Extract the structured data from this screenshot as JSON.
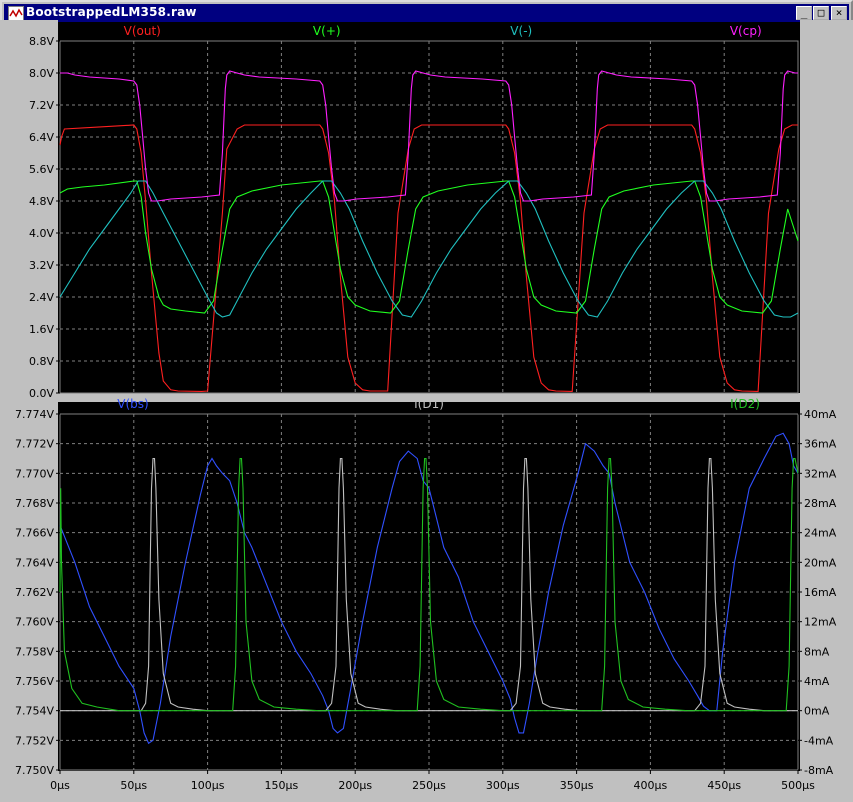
{
  "window": {
    "title": "BootstrappedLM358.raw",
    "controls": [
      "_",
      "□",
      "×"
    ]
  },
  "chart_data": [
    {
      "type": "line",
      "pane": "top",
      "y_ticks": [
        "0.0V",
        "0.8V",
        "1.6V",
        "2.4V",
        "3.2V",
        "4.0V",
        "4.8V",
        "5.6V",
        "6.4V",
        "7.2V",
        "8.0V",
        "8.8V"
      ],
      "ylim": [
        0,
        8.8
      ],
      "xlim": [
        0,
        500
      ],
      "grid": true,
      "series": [
        {
          "name": "V(out)",
          "color": "#ff2020",
          "x": [
            0,
            1,
            3,
            50,
            52,
            55,
            58,
            62,
            67,
            70,
            75,
            80,
            96,
            100,
            110,
            113,
            120,
            125,
            176,
            178,
            182,
            186,
            190,
            195,
            200,
            205,
            210,
            222,
            229,
            236,
            240,
            245,
            250,
            302,
            304,
            308,
            312,
            316,
            321,
            326,
            331,
            336,
            347,
            355,
            362,
            366,
            371,
            376,
            428,
            430,
            434,
            438,
            442,
            447,
            452,
            457,
            462,
            473,
            480,
            487,
            491,
            496,
            500
          ],
          "y": [
            6.2,
            6.4,
            6.6,
            6.7,
            6.6,
            6.0,
            4.8,
            3.0,
            1.0,
            0.3,
            0.08,
            0.05,
            0.04,
            0.05,
            4.5,
            6.1,
            6.6,
            6.7,
            6.7,
            6.6,
            6.0,
            4.8,
            2.9,
            0.9,
            0.25,
            0.08,
            0.05,
            0.05,
            4.5,
            6.1,
            6.6,
            6.7,
            6.7,
            6.7,
            6.6,
            6.0,
            4.8,
            2.9,
            0.9,
            0.25,
            0.08,
            0.05,
            0.04,
            4.5,
            6.1,
            6.6,
            6.7,
            6.7,
            6.7,
            6.6,
            6.0,
            4.8,
            2.9,
            0.9,
            0.25,
            0.08,
            0.05,
            0.04,
            4.5,
            6.1,
            6.6,
            6.7,
            6.7
          ]
        },
        {
          "name": "V(+)",
          "color": "#20ff20",
          "x": [
            0,
            5,
            15,
            30,
            50,
            52,
            55,
            58,
            62,
            67,
            70,
            75,
            85,
            98,
            104,
            110,
            115,
            120,
            130,
            150,
            176,
            178,
            182,
            186,
            190,
            195,
            200,
            210,
            224,
            230,
            236,
            241,
            246,
            256,
            276,
            302,
            304,
            308,
            312,
            316,
            321,
            326,
            336,
            350,
            356,
            362,
            367,
            372,
            382,
            402,
            428,
            430,
            434,
            438,
            442,
            447,
            452,
            462,
            476,
            482,
            488,
            493,
            500
          ],
          "y": [
            5.0,
            5.1,
            5.15,
            5.2,
            5.3,
            5.3,
            4.9,
            4.0,
            3.1,
            2.4,
            2.2,
            2.1,
            2.05,
            2.0,
            2.3,
            3.6,
            4.6,
            4.9,
            5.05,
            5.2,
            5.3,
            5.3,
            4.9,
            4.0,
            3.1,
            2.4,
            2.2,
            2.05,
            2.0,
            2.3,
            3.6,
            4.6,
            4.9,
            5.05,
            5.2,
            5.3,
            5.3,
            4.9,
            4.0,
            3.1,
            2.4,
            2.2,
            2.05,
            2.0,
            2.3,
            3.6,
            4.6,
            4.9,
            5.05,
            5.2,
            5.3,
            5.3,
            4.9,
            4.0,
            3.1,
            2.4,
            2.2,
            2.05,
            2.0,
            2.3,
            3.6,
            4.6,
            3.8
          ]
        },
        {
          "name": "V(-)",
          "color": "#20c0c0",
          "x": [
            0,
            10,
            20,
            30,
            40,
            48,
            53,
            58,
            63,
            70,
            80,
            90,
            100,
            106,
            110,
            115,
            120,
            130,
            140,
            150,
            160,
            170,
            178,
            184,
            190,
            196,
            205,
            215,
            225,
            232,
            238,
            245,
            255,
            265,
            275,
            285,
            295,
            304,
            310,
            316,
            322,
            331,
            341,
            351,
            358,
            364,
            371,
            381,
            391,
            401,
            411,
            421,
            430,
            436,
            442,
            448,
            457,
            467,
            477,
            484,
            490,
            495,
            500
          ],
          "y": [
            2.4,
            3.0,
            3.6,
            4.1,
            4.6,
            5.0,
            5.3,
            5.3,
            5.0,
            4.5,
            3.8,
            3.1,
            2.4,
            2.0,
            1.9,
            1.95,
            2.3,
            3.0,
            3.6,
            4.1,
            4.6,
            5.0,
            5.3,
            5.3,
            5.0,
            4.6,
            3.8,
            3.0,
            2.3,
            1.95,
            1.9,
            2.3,
            3.0,
            3.6,
            4.1,
            4.6,
            5.0,
            5.3,
            5.3,
            5.0,
            4.6,
            3.8,
            3.0,
            2.3,
            1.95,
            1.9,
            2.3,
            3.0,
            3.6,
            4.1,
            4.6,
            5.0,
            5.3,
            5.3,
            5.0,
            4.6,
            3.8,
            3.0,
            2.3,
            1.95,
            1.9,
            1.9,
            2.0
          ]
        },
        {
          "name": "V(cp)",
          "color": "#ff20ff",
          "x": [
            0,
            5,
            10,
            20,
            40,
            50,
            52,
            54,
            56,
            58,
            60,
            62,
            66,
            75,
            96,
            108,
            110,
            112,
            113,
            115,
            120,
            125,
            135,
            160,
            176,
            178,
            180,
            182,
            184,
            186,
            188,
            192,
            201,
            222,
            234,
            236,
            238,
            239,
            241,
            246,
            251,
            261,
            286,
            302,
            304,
            306,
            308,
            310,
            312,
            314,
            318,
            327,
            348,
            360,
            362,
            364,
            365,
            367,
            372,
            377,
            387,
            412,
            428,
            430,
            432,
            434,
            436,
            438,
            440,
            444,
            453,
            474,
            486,
            488,
            490,
            491,
            493,
            498,
            500
          ],
          "y": [
            8.0,
            8.0,
            7.95,
            7.9,
            7.85,
            7.8,
            7.7,
            7.2,
            6.4,
            5.6,
            5.0,
            4.8,
            4.8,
            4.85,
            4.9,
            4.95,
            6.0,
            7.6,
            7.95,
            8.05,
            8.0,
            7.95,
            7.9,
            7.85,
            7.8,
            7.7,
            7.2,
            6.4,
            5.6,
            5.0,
            4.8,
            4.8,
            4.85,
            4.9,
            4.95,
            6.0,
            7.6,
            7.95,
            8.05,
            8.0,
            7.95,
            7.9,
            7.85,
            7.8,
            7.7,
            7.2,
            6.4,
            5.6,
            5.0,
            4.8,
            4.8,
            4.85,
            4.9,
            4.95,
            6.0,
            7.6,
            7.95,
            8.05,
            8.0,
            7.95,
            7.9,
            7.85,
            7.8,
            7.7,
            7.2,
            6.4,
            5.6,
            5.0,
            4.8,
            4.8,
            4.85,
            4.9,
            4.95,
            6.0,
            7.6,
            7.95,
            8.05,
            8.0,
            8.0
          ]
        }
      ]
    },
    {
      "type": "line",
      "pane": "bottom",
      "y_ticks": [
        "7.750V",
        "7.752V",
        "7.754V",
        "7.756V",
        "7.758V",
        "7.760V",
        "7.762V",
        "7.764V",
        "7.766V",
        "7.768V",
        "7.770V",
        "7.772V",
        "7.774V"
      ],
      "ylim": [
        7.75,
        7.774
      ],
      "y2_ticks": [
        "-8mA",
        "-4mA",
        "0mA",
        "4mA",
        "8mA",
        "12mA",
        "16mA",
        "20mA",
        "24mA",
        "28mA",
        "32mA",
        "36mA",
        "40mA"
      ],
      "y2lim": [
        -8,
        40
      ],
      "x_ticks": [
        "0µs",
        "50µs",
        "100µs",
        "150µs",
        "200µs",
        "250µs",
        "300µs",
        "350µs",
        "400µs",
        "450µs",
        "500µs"
      ],
      "xlim": [
        0,
        500
      ],
      "grid": true,
      "series": [
        {
          "name": "V(bs)",
          "color": "#3050ff",
          "axis": "left",
          "x": [
            0,
            10,
            20,
            30,
            40,
            50,
            54,
            57,
            60,
            63,
            68,
            75,
            85,
            95,
            100,
            103,
            106,
            110,
            115,
            120,
            125,
            130,
            140,
            150,
            160,
            170,
            178,
            182,
            185,
            188,
            192,
            197,
            205,
            215,
            225,
            230,
            236,
            242,
            246,
            250,
            255,
            260,
            270,
            280,
            290,
            300,
            305,
            308,
            311,
            314,
            318,
            323,
            331,
            341,
            351,
            356,
            362,
            368,
            372,
            376,
            381,
            386,
            396,
            406,
            416,
            426,
            432,
            436,
            440,
            445,
            449,
            457,
            467,
            477,
            485,
            490,
            494,
            497,
            500
          ],
          "y": [
            7.7665,
            7.764,
            7.761,
            7.759,
            7.757,
            7.7555,
            7.754,
            7.7525,
            7.7518,
            7.752,
            7.7545,
            7.759,
            7.764,
            7.7685,
            7.7705,
            7.771,
            7.7705,
            7.77,
            7.7695,
            7.768,
            7.766,
            7.765,
            7.7625,
            7.76,
            7.758,
            7.7565,
            7.755,
            7.754,
            7.7528,
            7.7525,
            7.7528,
            7.7555,
            7.76,
            7.765,
            7.769,
            7.7708,
            7.7715,
            7.771,
            7.7695,
            7.769,
            7.767,
            7.765,
            7.763,
            7.76,
            7.758,
            7.756,
            7.7548,
            7.7535,
            7.7525,
            7.7525,
            7.7545,
            7.7575,
            7.762,
            7.7665,
            7.77,
            7.772,
            7.7715,
            7.7705,
            7.77,
            7.768,
            7.766,
            7.764,
            7.762,
            7.7595,
            7.7575,
            7.756,
            7.755,
            7.7543,
            7.754,
            7.754,
            7.758,
            7.764,
            7.769,
            7.771,
            7.7725,
            7.7727,
            7.772,
            7.7705,
            7.77
          ]
        },
        {
          "name": "I(D1)",
          "color": "#c0c0c0",
          "axis": "right",
          "x": [
            0,
            55,
            58,
            60,
            61,
            62,
            63,
            64,
            65,
            67,
            70,
            75,
            80,
            90,
            100,
            180,
            184,
            187,
            188,
            189,
            190,
            191,
            192,
            194,
            197,
            202,
            207,
            217,
            227,
            305,
            309,
            312,
            313,
            314,
            315,
            316,
            317,
            319,
            322,
            327,
            332,
            342,
            352,
            430,
            434,
            437,
            438,
            439,
            440,
            441,
            442,
            444,
            447,
            452,
            457,
            467,
            477,
            500
          ],
          "y": [
            0,
            0,
            1,
            6,
            18,
            30,
            34,
            34,
            30,
            15,
            5,
            1,
            0.5,
            0.2,
            0,
            0,
            1,
            6,
            18,
            30,
            34,
            34,
            30,
            15,
            5,
            1,
            0.5,
            0.2,
            0,
            0,
            1,
            6,
            18,
            30,
            34,
            34,
            30,
            15,
            5,
            1,
            0.5,
            0.2,
            0,
            0,
            1,
            6,
            18,
            30,
            34,
            34,
            30,
            15,
            5,
            1,
            0.5,
            0.2,
            0,
            0
          ]
        },
        {
          "name": "I(D2)",
          "color": "#20c020",
          "axis": "right",
          "x": [
            0,
            0.5,
            1,
            3,
            8,
            15,
            25,
            40,
            117,
            119,
            120,
            121,
            122,
            123,
            124,
            126,
            130,
            135,
            145,
            160,
            175,
            242,
            244,
            245,
            246,
            247,
            248,
            249,
            251,
            255,
            260,
            270,
            285,
            300,
            367,
            369,
            370,
            371,
            372,
            373,
            374,
            376,
            380,
            385,
            395,
            410,
            425,
            492,
            494,
            495,
            496,
            497,
            498,
            500
          ],
          "y": [
            16,
            30,
            20,
            8,
            3,
            1,
            0.5,
            0,
            0,
            6,
            18,
            30,
            34,
            34,
            30,
            12,
            4,
            1.5,
            0.5,
            0.2,
            0,
            0,
            6,
            18,
            30,
            34,
            34,
            30,
            12,
            4,
            1.5,
            0.5,
            0.2,
            0,
            0,
            6,
            18,
            30,
            34,
            34,
            30,
            12,
            4,
            1.5,
            0.5,
            0.2,
            0,
            0,
            6,
            18,
            30,
            34,
            34,
            32
          ]
        }
      ]
    }
  ]
}
